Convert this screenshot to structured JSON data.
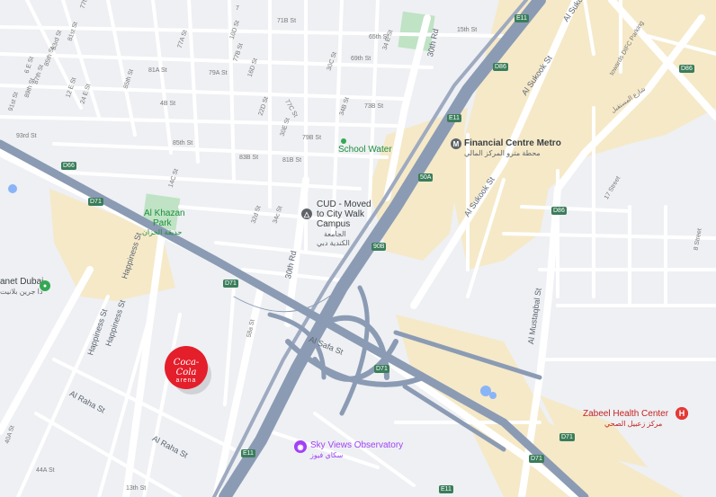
{
  "colors": {
    "background": "#eef0f3",
    "street": "#ffffff",
    "highway": "#8b9bb4",
    "commercial_area": "#f5e9c8",
    "park": "#bfe3c4",
    "water": "#8ab4f8",
    "shield": "#3a7d5a",
    "coke_red": "#e41e2b",
    "health_red": "#e53935"
  },
  "streets": {
    "e77th": "77th St",
    "e81st": "81st St",
    "e83rd": "83rd St",
    "e85th_w": "85th St",
    "e87th": "87th St",
    "e89th": "89th St",
    "e91st": "91st St",
    "e93rd": "93rd St",
    "e6e": "6 E St",
    "e12e": "12 E St",
    "e24e": "24 E St",
    "e85th_n": "85th St",
    "e77a": "77A St",
    "e81a": "81A St",
    "e4b": "4B St",
    "e85th_c": "85th St",
    "e14c": "14C St",
    "e10d": "10D St",
    "e77b": "77B St",
    "e79a": "79A St",
    "e16d": "16D St",
    "e22d": "22D St",
    "e71b": "71B St",
    "e77c": "77C St",
    "e83b": "83B St",
    "e30e": "30E St",
    "e79b": "79B St",
    "e81b": "81B St",
    "e34b": "34B St",
    "e73b": "73B St",
    "e65th": "65th St",
    "e30c": "30C St",
    "e69th": "69th St",
    "e34e": "34 E St",
    "e30th_rd_n": "30th Rd",
    "e15th": "15th St",
    "e32d": "32d St",
    "e34c": "34c St",
    "e30th_rd_s": "30th Rd",
    "happiness1": "Happiness St",
    "happiness2": "Happiness St",
    "happiness3": "Happiness St",
    "alraha1": "Al Raha St",
    "alraha2": "Al Raha St",
    "e40a": "40A St",
    "e44a": "44A St",
    "e13th": "13th St",
    "e58a": "58a St",
    "alsafa": "Al Safa St",
    "alsukook1": "Al Sukook St",
    "alsukook2": "Al Sukook St",
    "alsukook3": "Al Sukook St",
    "alsukook_ar": "شارع المستقبل",
    "towards_difc": "towards DIFC Parking",
    "e17th": "17 Street",
    "e8th": "8 Street",
    "almustaqbal": "Al Mustaqbal St",
    "e7th": "7"
  },
  "shields": {
    "s1": "D66",
    "s2": "D86",
    "s3": "D71",
    "s4": "D71",
    "s5": "D71",
    "s6": "D71",
    "s7": "E11",
    "s8": "E11",
    "s9": "D86",
    "s10": "D86",
    "s11": "50A",
    "s12": "90B",
    "s13": "E11",
    "s14": "E11",
    "s15": "D71"
  },
  "parks": {
    "al_khazan": "Al Khazan",
    "al_khazan_2": "Park",
    "al_khazan_ar": "حديقة الخزان"
  },
  "pois": {
    "school_water": "School Water",
    "metro": "Financial Centre Metro",
    "metro_ar": "محطة مترو المركز المالي",
    "cud_1": "CUD - Moved",
    "cud_2": "to City Walk",
    "cud_3": "Campus",
    "cud_ar_1": "الجامعة",
    "cud_ar_2": "الكندية دبي",
    "planet_1": "anet Dubai",
    "planet_ar": "دا جرين بلانيت",
    "coke_1": "Coca-Cola",
    "coke_2": "arena",
    "sky_views": "Sky Views Observatory",
    "sky_views_ar": "سكاي فيوز",
    "health": "Zabeel Health Center",
    "health_ar": "مركز زعبيل الصحي"
  },
  "icons": {
    "metro": "metro-icon",
    "school": "school-icon",
    "health": "hospital-icon",
    "sky": "camera-icon",
    "planet": "paw-icon"
  }
}
